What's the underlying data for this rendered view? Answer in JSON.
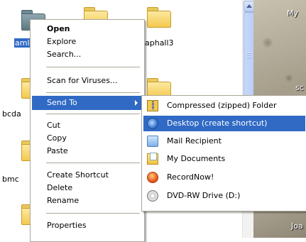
{
  "explorer": {
    "folders": [
      {
        "label": "",
        "selected": false
      },
      {
        "label": "",
        "selected": false
      },
      {
        "label": "",
        "selected": false
      },
      {
        "label": "aml",
        "selected": true
      },
      {
        "label": "aphall3",
        "selected": false
      },
      {
        "label": "bcda",
        "selected": false
      },
      {
        "label": "bmc",
        "selected": false
      }
    ]
  },
  "desktop": {
    "texts": [
      "My",
      "sc",
      "Joa"
    ]
  },
  "context_menu": {
    "items": [
      {
        "label": "Open",
        "bold": true
      },
      {
        "label": "Explore"
      },
      {
        "label": "Search..."
      },
      {
        "label": "Scan for Viruses..."
      },
      {
        "label": "Send To",
        "highlighted": true,
        "submenu": true
      },
      {
        "label": "Cut"
      },
      {
        "label": "Copy"
      },
      {
        "label": "Paste"
      },
      {
        "label": "Create Shortcut"
      },
      {
        "label": "Delete"
      },
      {
        "label": "Rename"
      },
      {
        "label": "Properties"
      }
    ]
  },
  "send_to_menu": {
    "items": [
      {
        "label": "Compressed (zipped) Folder",
        "icon": "zip-folder-icon"
      },
      {
        "label": "Desktop (create shortcut)",
        "icon": "desktop-icon",
        "highlighted": true
      },
      {
        "label": "Mail Recipient",
        "icon": "mail-icon"
      },
      {
        "label": "My Documents",
        "icon": "my-documents-icon"
      },
      {
        "label": "RecordNow!",
        "icon": "recordnow-icon"
      },
      {
        "label": "DVD-RW Drive (D:)",
        "icon": "dvd-drive-icon"
      }
    ]
  },
  "colors": {
    "highlight": "#316ac5",
    "menu_border": "#aca899",
    "folder_yellow": "#f3c94e"
  }
}
